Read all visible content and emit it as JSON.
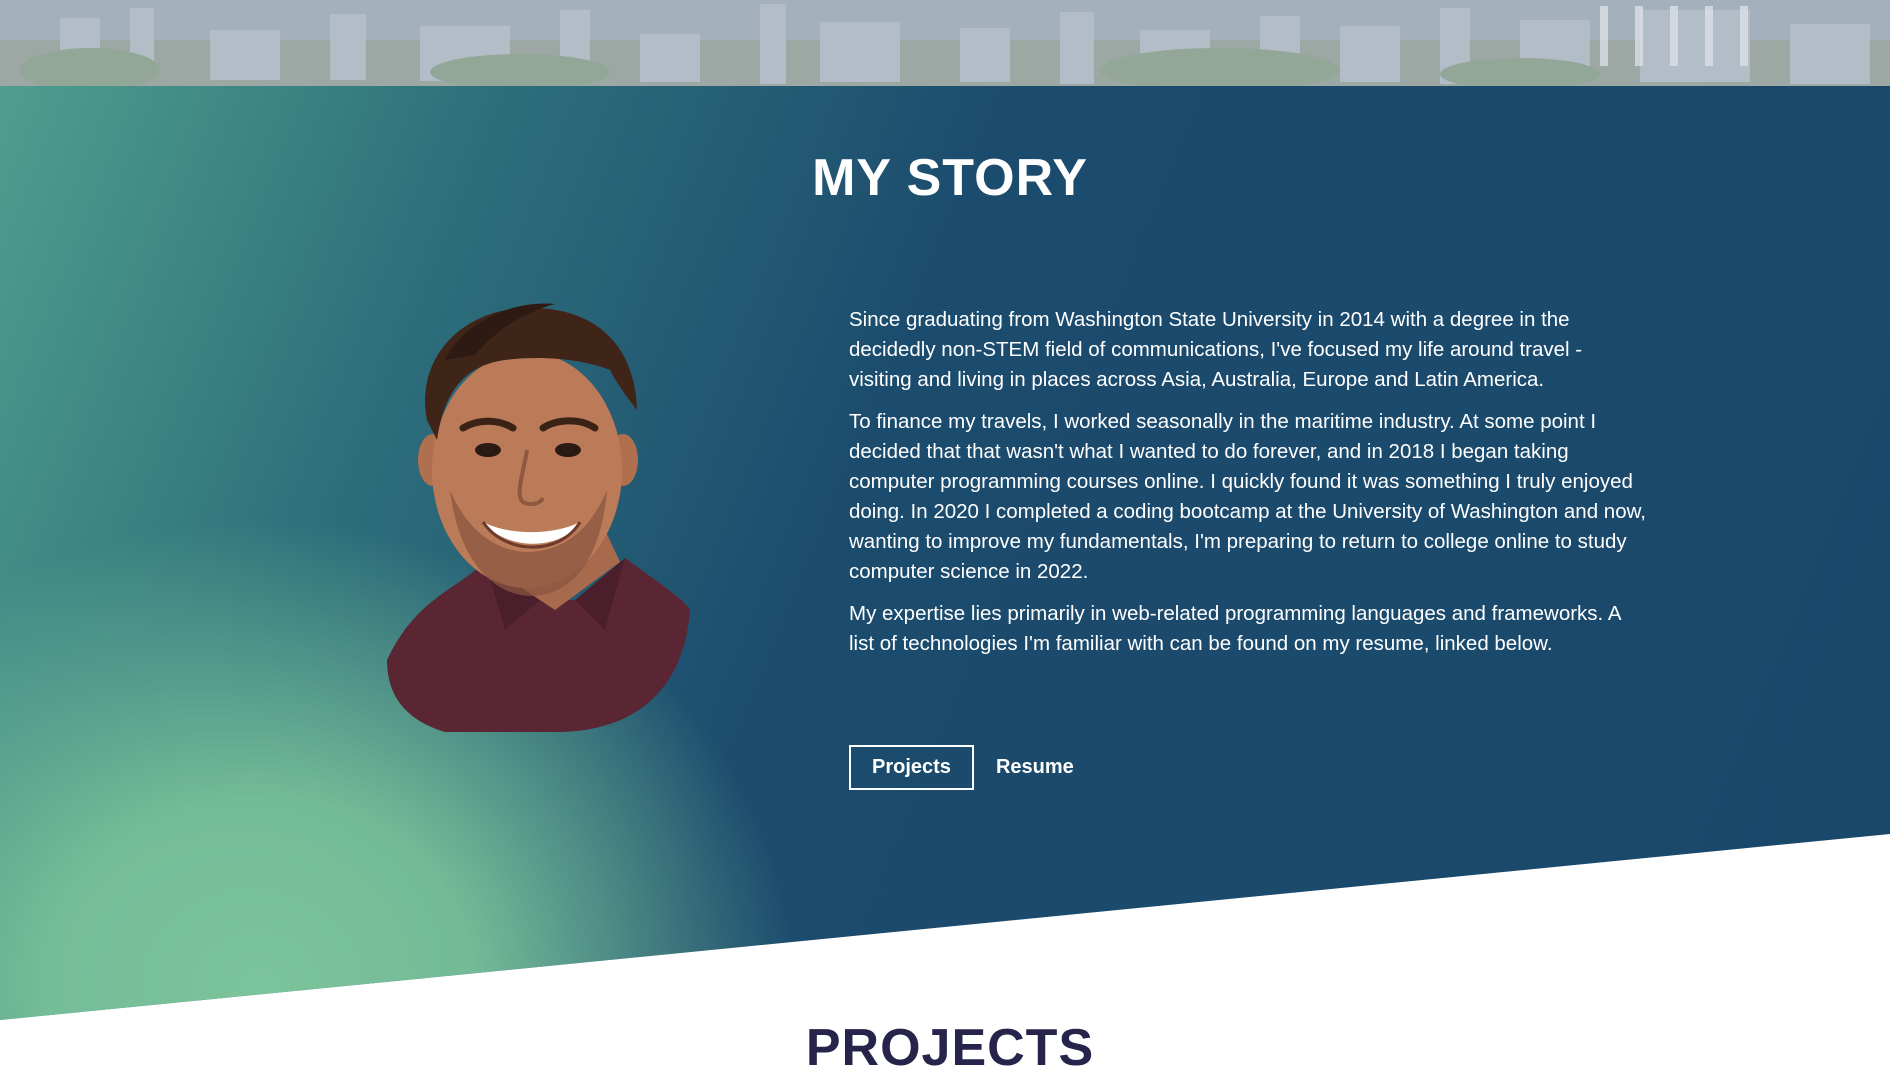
{
  "story": {
    "title": "MY STORY",
    "paragraphs": [
      "Since graduating from Washington State University in 2014 with a degree in the decidedly non-STEM field of communications, I've focused my life around travel - visiting and living in places across Asia, Australia, Europe and Latin America.",
      "To finance my travels, I worked seasonally in the maritime industry. At some point I decided that that wasn't what I wanted to do forever, and in 2018 I began taking computer programming courses online. I quickly found it was something I truly enjoyed doing. In 2020 I completed a coding bootcamp at the University of Washington and now, wanting to improve my fundamentals, I'm preparing to return to college online to study computer science in 2022.",
      "My expertise lies primarily in web-related programming languages and frameworks. A list of technologies I'm familiar with can be found on my resume, linked below."
    ],
    "buttons": {
      "projects": "Projects",
      "resume": "Resume"
    }
  },
  "projects": {
    "title": "PROJECTS"
  },
  "colors": {
    "gradient_dark": "#1a486b",
    "gradient_light": "#7cc49b",
    "projects_title": "#26244a"
  }
}
